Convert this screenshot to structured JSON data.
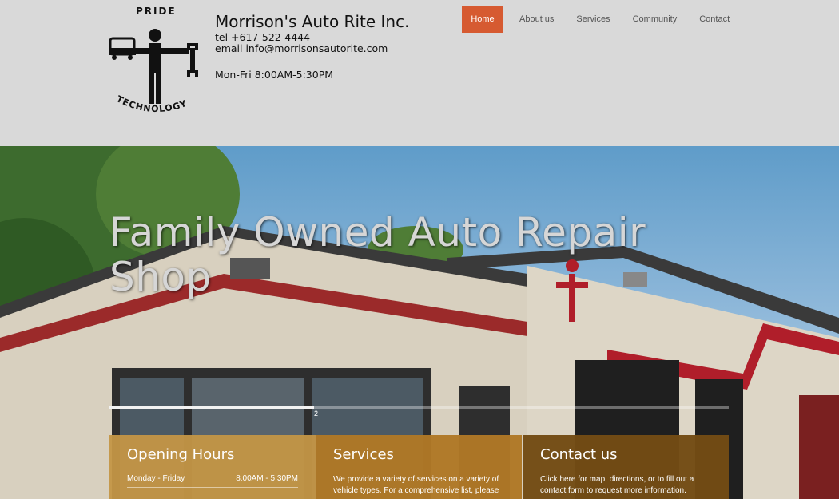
{
  "logo": {
    "top_text": "PRIDE",
    "bottom_text": "TECHNOLOGY"
  },
  "company": {
    "name": "Morrison's Auto Rite Inc.",
    "tel": "tel +617-522-4444",
    "email": "email info@morrisonsautorite.com",
    "hours": "Mon-Fri 8:00AM-5:30PM"
  },
  "nav": {
    "home": "Home",
    "about": "About us",
    "services": "Services",
    "community": "Community",
    "contact": "Contact"
  },
  "hero": {
    "title": "Family Owned Auto Repair Shop",
    "slide_number": "2",
    "slide_progress": 0.33
  },
  "panels": {
    "hours": {
      "title": "Opening Hours",
      "day": "Monday - Friday",
      "time": "8.00AM - 5.30PM"
    },
    "services": {
      "title": "Services",
      "text": "We provide a variety of services on a variety of vehicle types. For a comprehensive list, please"
    },
    "contact": {
      "title": "Contact us",
      "text": "Click here for map, directions, or to fill out a contact form to request more information."
    }
  },
  "colors": {
    "nav_active": "#d65a31",
    "header_bg": "#d9d9d9",
    "panel_hours": "#c49646",
    "panel_services": "#af7826",
    "panel_contact": "#734b14"
  }
}
